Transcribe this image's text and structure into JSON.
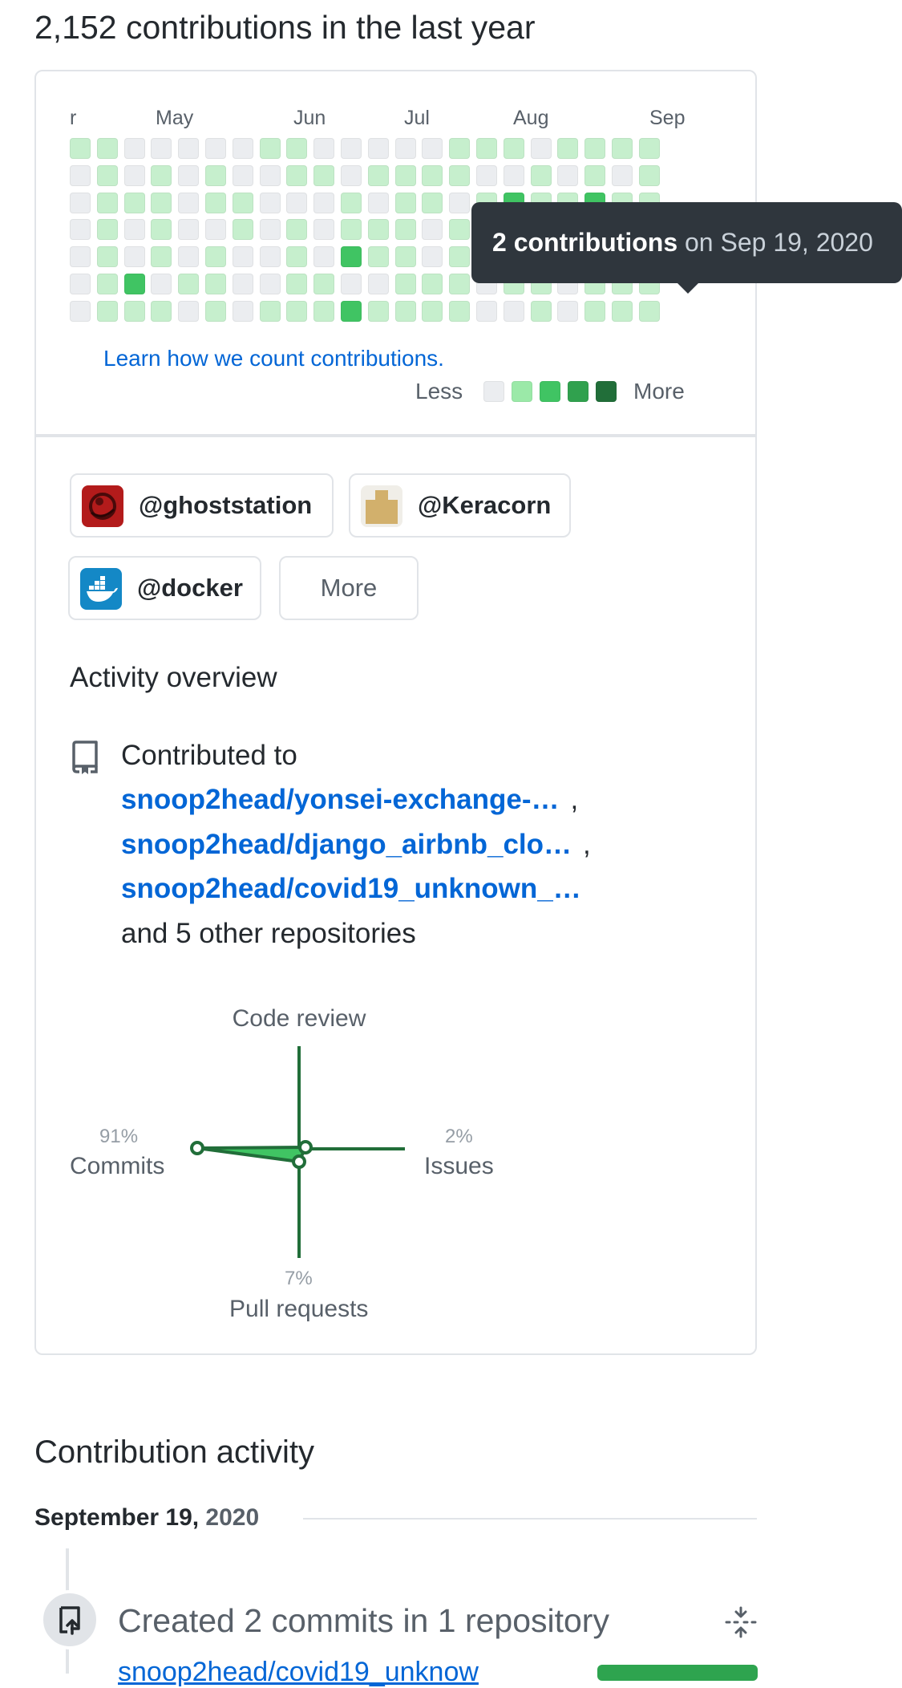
{
  "header": {
    "title": "2,152 contributions in the last year"
  },
  "calendar": {
    "months": [
      "r",
      "May",
      "Jun",
      "Jul",
      "Aug",
      "Sep"
    ],
    "learn_link": "Learn how we count contributions.",
    "legend_less": "Less",
    "legend_more": "More",
    "colors": [
      "#ebedf0",
      "#9be9a8",
      "#40c463",
      "#30a14e",
      "#216e39"
    ],
    "tooltip": {
      "count": "2 contributions",
      "date": " on Sep 19, 2020"
    }
  },
  "orgs": [
    {
      "handle": "@ghoststation",
      "icon": "ghoststation-avatar"
    },
    {
      "handle": "@Keracorn",
      "icon": "keracorn-avatar"
    },
    {
      "handle": "@docker",
      "icon": "docker-avatar"
    }
  ],
  "orgs_more": "More",
  "activity": {
    "title": "Activity overview",
    "contributed_to": "Contributed to",
    "repos": [
      "snoop2head/yonsei-exchange-…",
      "snoop2head/django_airbnb_clo…",
      "snoop2head/covid19_unknown_…"
    ],
    "others": "and 5 other repositories",
    "radar": {
      "code_review": "Code review",
      "commits": "Commits",
      "commits_pct": "91%",
      "issues": "Issues",
      "issues_pct": "2%",
      "pull_requests": "Pull requests",
      "pull_requests_pct": "7%"
    }
  },
  "contribution_activity": {
    "title": "Contribution activity",
    "date_bold": "September 19,",
    "date_year": " 2020",
    "event": "Created 2 commits in 1 repository",
    "event_repo": "snoop2head/covid19_unknow"
  },
  "comma": ","
}
